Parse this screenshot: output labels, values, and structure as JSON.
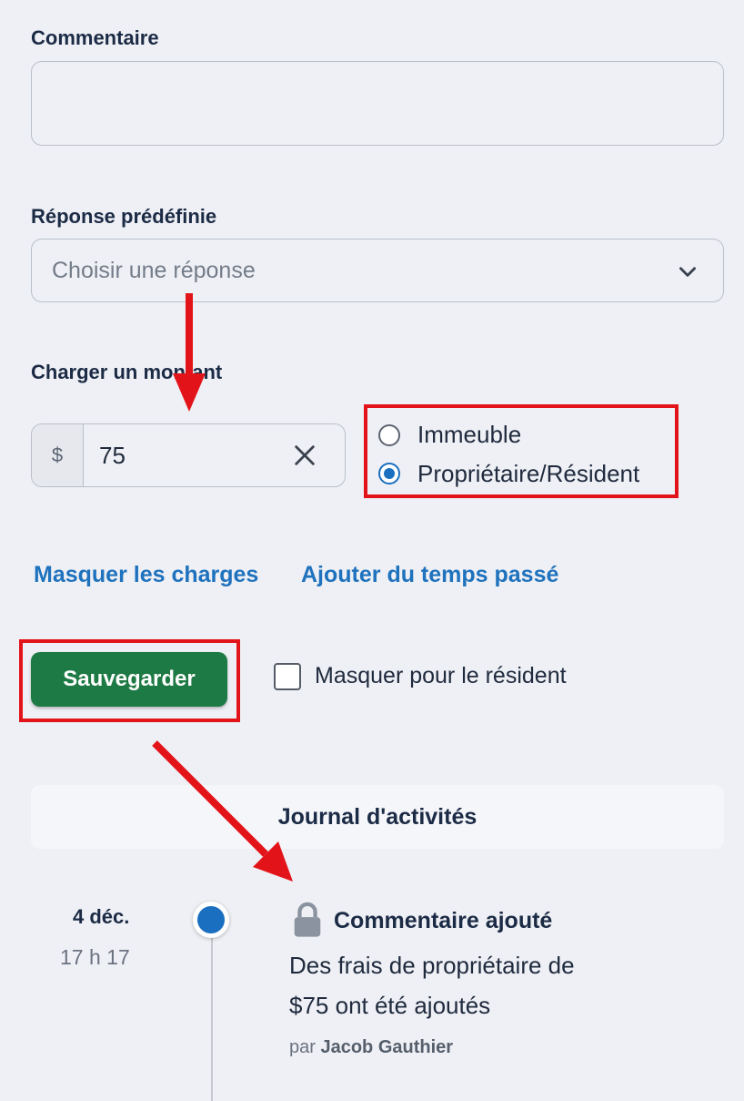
{
  "comment": {
    "label": "Commentaire",
    "value": ""
  },
  "predefined": {
    "label": "Réponse prédéfinie",
    "placeholder": "Choisir une réponse"
  },
  "charge": {
    "label": "Charger un montant",
    "currency": "$",
    "amount": "75",
    "options": [
      {
        "label": "Immeuble",
        "selected": false
      },
      {
        "label": "Propriétaire/Résident",
        "selected": true
      }
    ]
  },
  "links": {
    "hide_charges": "Masquer les charges",
    "add_time": "Ajouter du temps passé"
  },
  "actions": {
    "save_label": "Sauvegarder",
    "hide_for_resident_label": "Masquer pour le résident",
    "hide_for_resident_checked": false
  },
  "journal": {
    "title": "Journal d'activités",
    "entries": [
      {
        "date": "4 déc.",
        "time": "17 h 17",
        "title": "Commentaire ajouté",
        "body_line1": "Des frais de propriétaire de",
        "body_line2": "$75 ont été ajoutés",
        "by_prefix": "par",
        "author": "Jacob Gauthier"
      }
    ]
  },
  "colors": {
    "accent": "#1a6fc0",
    "save_button": "#1e7a44",
    "link": "#1f72bd",
    "annotation_red": "#e31419",
    "background": "#eef0f5"
  }
}
